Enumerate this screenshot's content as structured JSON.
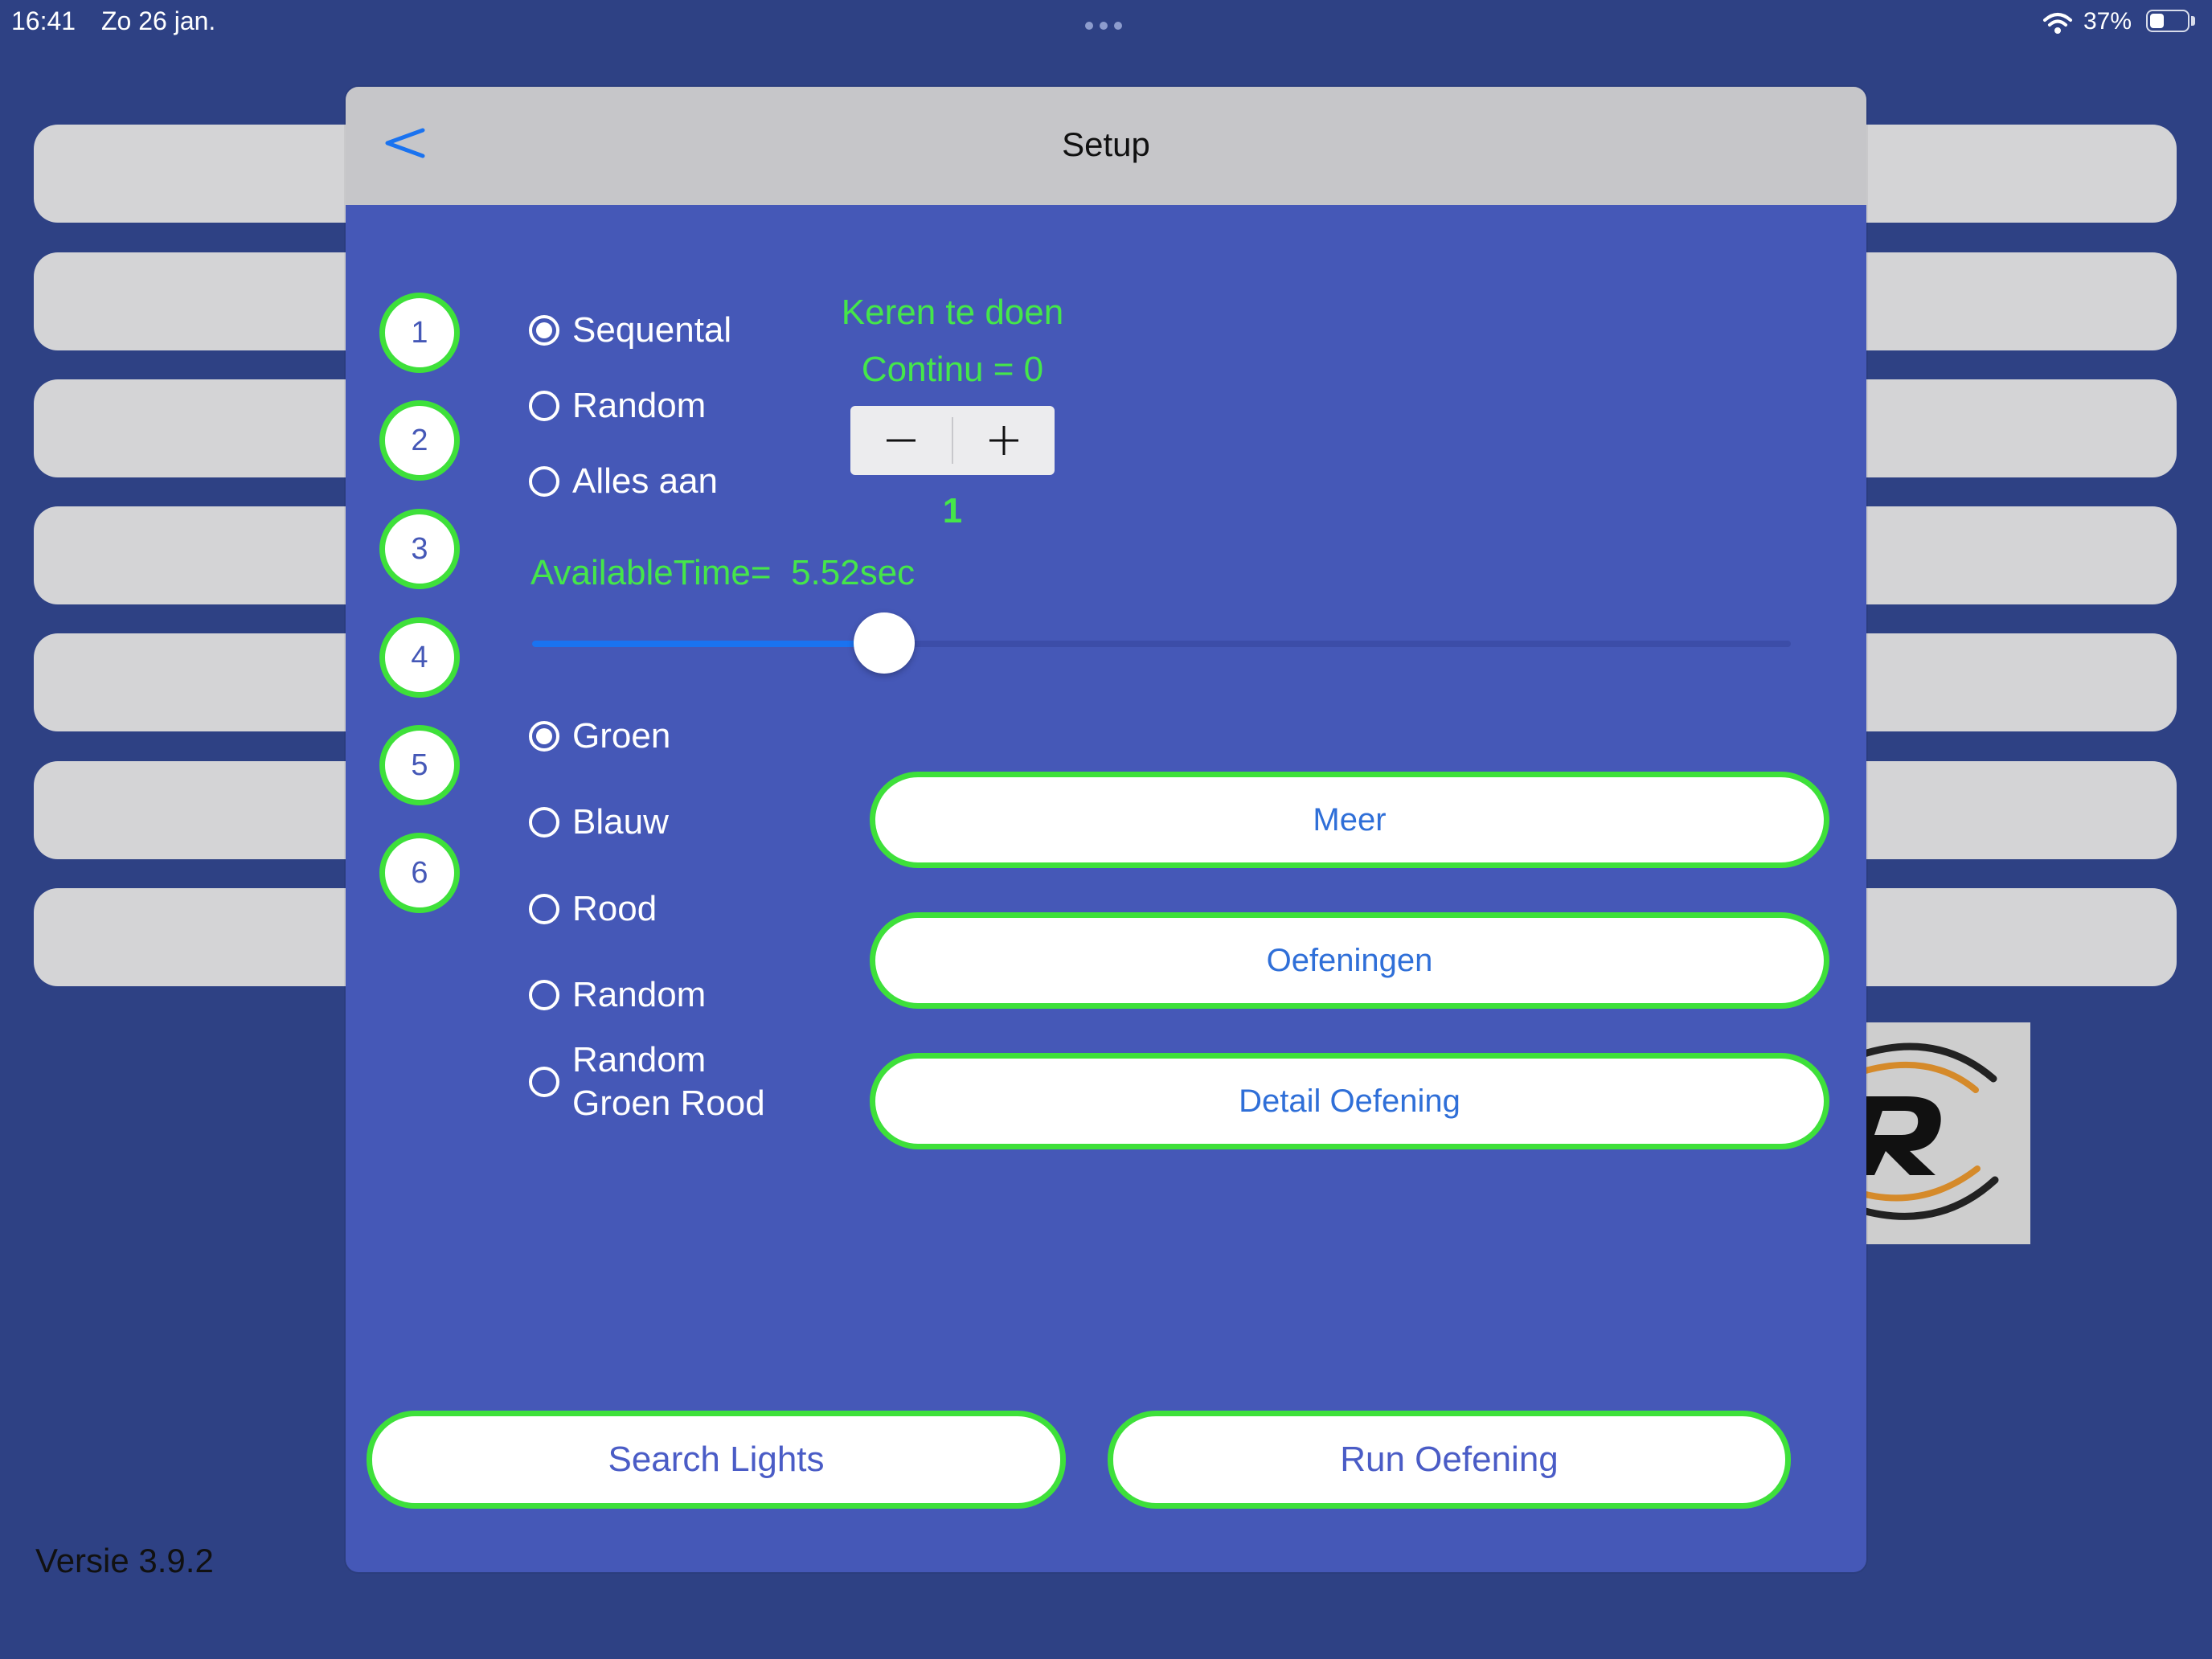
{
  "status_bar": {
    "time": "16:41",
    "date": "Zo 26 jan.",
    "battery_percent": "37%",
    "battery_level": 0.37
  },
  "footer": {
    "version": "Versie 3.9.2"
  },
  "setup": {
    "title": "Setup",
    "back_label": "<",
    "light_numbers": [
      "1",
      "2",
      "3",
      "4",
      "5",
      "6"
    ],
    "mode_options": [
      {
        "label": "Sequental",
        "selected": true
      },
      {
        "label": "Random",
        "selected": false
      },
      {
        "label": "Alles aan",
        "selected": false
      }
    ],
    "repeat_label_1": "Keren te doen",
    "repeat_label_2": "Continu = 0",
    "repeat_value": "1",
    "available_time_label": "AvailableTime=",
    "available_time_value": "5.52sec",
    "slider_fraction": 0.28,
    "color_options": [
      {
        "label": "Groen",
        "selected": true
      },
      {
        "label": "Blauw",
        "selected": false
      },
      {
        "label": "Rood",
        "selected": false
      },
      {
        "label": "Random",
        "selected": false
      },
      {
        "label_line1": "Random",
        "label_line2": "Groen Rood",
        "selected": false
      }
    ],
    "buttons": {
      "meer": "Meer",
      "oefeningen": "Oefeningen",
      "detail": "Detail Oefening",
      "search": "Search Lights",
      "run": "Run Oefening"
    }
  },
  "colors": {
    "background": "#2e4184",
    "panel": "#4558b7",
    "accent_green": "#3ee03a",
    "link_blue": "#2f6fd8",
    "slider_fill": "#1a73f0"
  }
}
